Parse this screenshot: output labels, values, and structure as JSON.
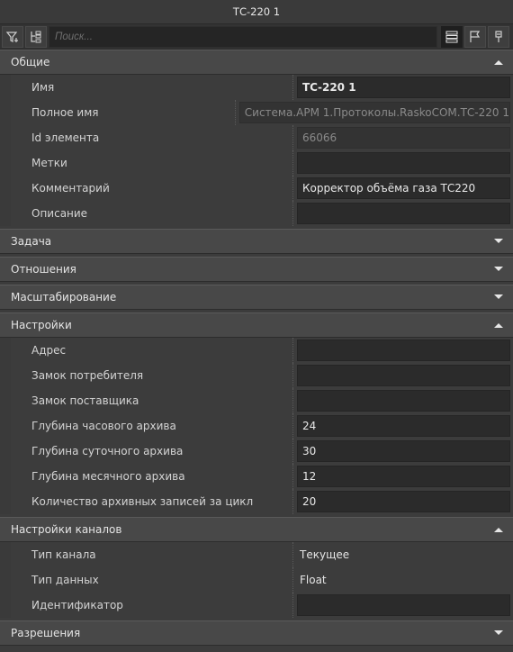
{
  "window": {
    "title": "ТС-220 1"
  },
  "toolbar": {
    "search_placeholder": "Поиск..."
  },
  "sections": {
    "general": {
      "title": "Общие",
      "rows": [
        {
          "label": "Имя",
          "value": "ТС-220 1"
        },
        {
          "label": "Полное имя",
          "value": "Система.АРМ 1.Протоколы.RaskoCOM.ТС-220 1"
        },
        {
          "label": "Id элемента",
          "value": "66066"
        },
        {
          "label": "Метки",
          "value": ""
        },
        {
          "label": "Комментарий",
          "value": "Корректор объёма газа ТС220"
        },
        {
          "label": "Описание",
          "value": ""
        }
      ]
    },
    "task": {
      "title": "Задача"
    },
    "relations": {
      "title": "Отношения"
    },
    "scaling": {
      "title": "Масштабирование"
    },
    "settings": {
      "title": "Настройки",
      "rows": [
        {
          "label": "Адрес",
          "value": ""
        },
        {
          "label": "Замок потребителя",
          "value": ""
        },
        {
          "label": "Замок поставщика",
          "value": ""
        },
        {
          "label": "Глубина часового архива",
          "value": "24"
        },
        {
          "label": "Глубина суточного архива",
          "value": "30"
        },
        {
          "label": "Глубина месячного архива",
          "value": "12"
        },
        {
          "label": "Количество архивных записей за цикл",
          "value": "20"
        }
      ]
    },
    "channel_settings": {
      "title": "Настройки каналов",
      "rows": [
        {
          "label": "Тип канала",
          "value": "Текущее"
        },
        {
          "label": "Тип данных",
          "value": "Float"
        },
        {
          "label": "Идентификатор",
          "value": ""
        }
      ]
    },
    "permissions": {
      "title": "Разрешения"
    }
  }
}
